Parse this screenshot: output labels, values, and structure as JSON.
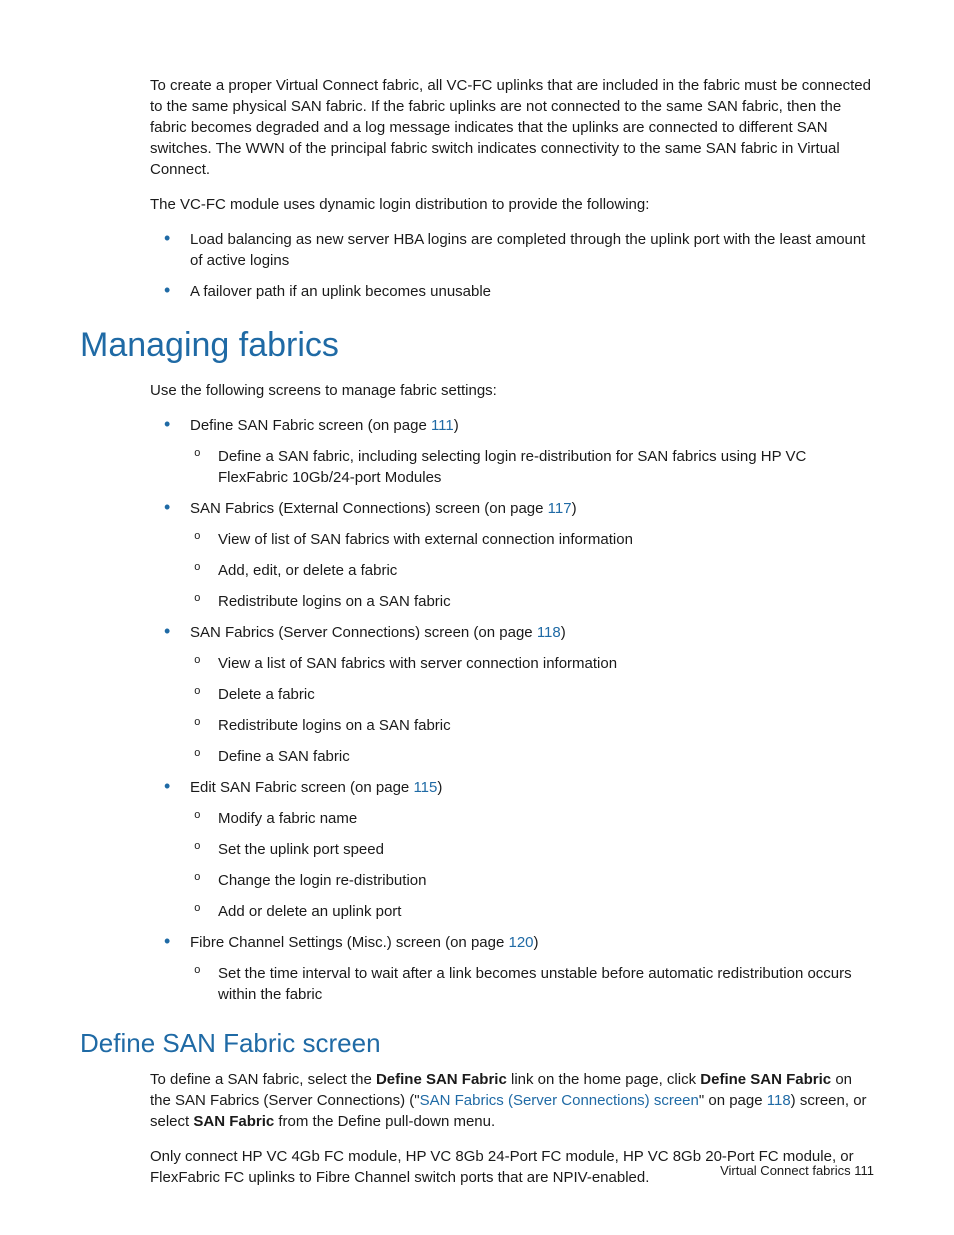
{
  "para1": "To create a proper Virtual Connect fabric, all VC-FC uplinks that are included in the fabric must be connected to the same physical SAN fabric. If the fabric uplinks are not connected to the same SAN fabric, then the fabric becomes degraded and a log message indicates that the uplinks are connected to different SAN switches. The WWN of the principal fabric switch indicates connectivity to the same SAN fabric in Virtual Connect.",
  "para2": "The VC-FC module uses dynamic login distribution to provide the following:",
  "list1": {
    "item1": "Load balancing as new server HBA logins are completed through the uplink port with the least amount of active logins",
    "item2": "A failover path if an uplink becomes unusable"
  },
  "h1": "Managing fabrics",
  "para3": "Use the following screens to manage fabric settings:",
  "sec1": {
    "pre": "Define SAN Fabric screen (on page ",
    "link": "111",
    "post": ")",
    "sub1": "Define a SAN fabric, including selecting login re-distribution for SAN fabrics using HP VC FlexFabric 10Gb/24-port Modules"
  },
  "sec2": {
    "pre": "SAN Fabrics (External Connections) screen (on page ",
    "link": "117",
    "post": ")",
    "sub1": "View of list of SAN fabrics with external connection information",
    "sub2": "Add, edit, or delete a fabric",
    "sub3": "Redistribute logins on a SAN fabric"
  },
  "sec3": {
    "pre": "SAN Fabrics (Server Connections) screen (on page ",
    "link": "118",
    "post": ")",
    "sub1": "View a list of SAN fabrics with server connection information",
    "sub2": "Delete a fabric",
    "sub3": "Redistribute logins on a SAN fabric",
    "sub4": "Define a SAN fabric"
  },
  "sec4": {
    "pre": "Edit SAN Fabric screen (on page ",
    "link": "115",
    "post": ")",
    "sub1": "Modify a fabric name",
    "sub2": "Set the uplink port speed",
    "sub3": "Change the login re-distribution",
    "sub4": "Add or delete an uplink port"
  },
  "sec5": {
    "pre": "Fibre Channel Settings (Misc.) screen (on page ",
    "link": "120",
    "post": ")",
    "sub1": "Set the time interval to wait after a link becomes unstable before automatic redistribution occurs within the fabric"
  },
  "h2": "Define SAN Fabric screen",
  "def": {
    "p1a": "To define a SAN fabric, select the ",
    "b1": "Define SAN Fabric",
    "p1b": " link on the home page, click ",
    "b2": "Define SAN Fabric",
    "p1c": " on the SAN Fabrics (Server Connections) (\"",
    "link1": "SAN Fabrics (Server Connections) screen",
    "p1d": "\" on page ",
    "link2": "118",
    "p1e": ") screen, or select ",
    "b3": "SAN Fabric",
    "p1f": " from the Define pull-down menu."
  },
  "para_last": "Only connect HP VC 4Gb FC module, HP VC 8Gb 24-Port FC module, HP VC 8Gb 20-Port FC module, or FlexFabric FC uplinks to Fibre Channel switch ports that are NPIV-enabled.",
  "footer": "Virtual Connect fabrics   111"
}
